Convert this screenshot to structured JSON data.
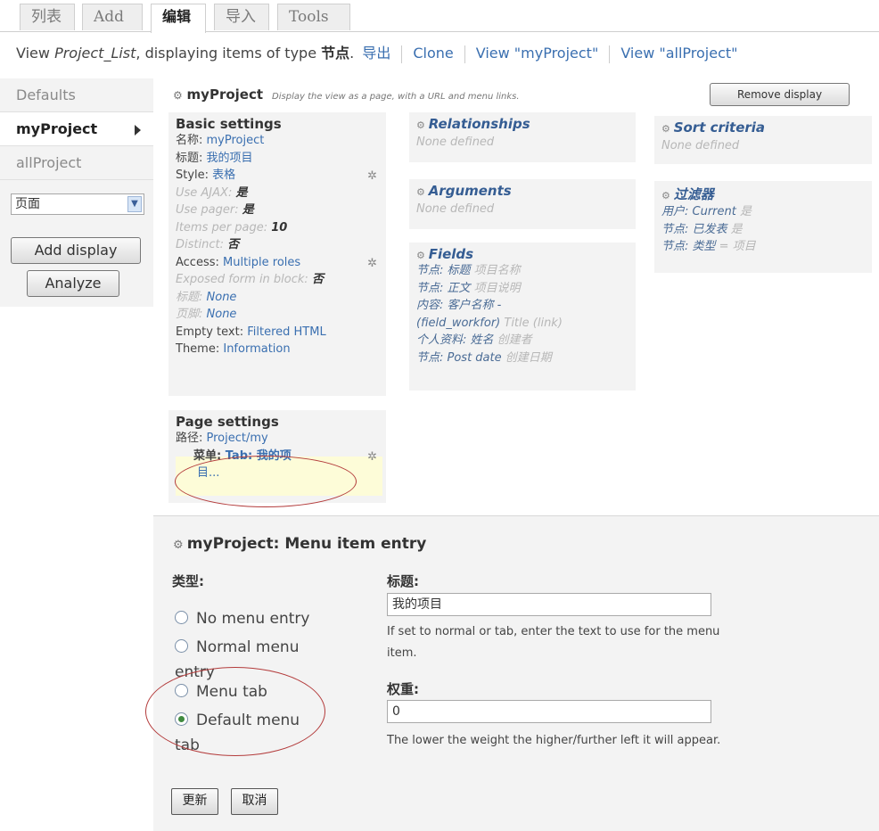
{
  "tabs": [
    {
      "label": "列表"
    },
    {
      "label": "Add"
    },
    {
      "label": "编辑",
      "active": true
    },
    {
      "label": "导入"
    },
    {
      "label": "Tools"
    }
  ],
  "header": {
    "prefix": "View ",
    "view_name": "Project_List",
    "mid": ", displaying items of type ",
    "type": "节点",
    "dot": ".",
    "links": [
      "导出",
      "Clone",
      "View \"myProject\"",
      "View \"allProject\""
    ]
  },
  "sidebar": {
    "items": [
      "Defaults",
      "myProject",
      "allProject"
    ],
    "select_value": "页面",
    "add_display": "Add display",
    "analyze": "Analyze"
  },
  "display": {
    "name": "myProject",
    "desc": "Display the view as a page, with a URL and menu links.",
    "remove_button": "Remove display"
  },
  "basic_settings": {
    "title": "Basic settings",
    "rows": [
      {
        "label": "名称: ",
        "value": "myProject"
      },
      {
        "label": "标题: ",
        "value": "我的项目"
      },
      {
        "label": "Style: ",
        "value": "表格"
      },
      {
        "label": "Use AJAX: ",
        "value": "是"
      },
      {
        "label": "Use pager: ",
        "value": "是"
      },
      {
        "label": "Items per page: ",
        "value": "10"
      },
      {
        "label": "Distinct: ",
        "value": "否"
      },
      {
        "label": "Access: ",
        "value": "Multiple roles"
      },
      {
        "label": "Exposed form in block: ",
        "value": "否"
      },
      {
        "label": "标题: ",
        "value": "None"
      },
      {
        "label": "页脚: ",
        "value": "None"
      },
      {
        "label": "Empty text: ",
        "value": "Filtered HTML"
      },
      {
        "label": "Theme: ",
        "value": "Information"
      }
    ]
  },
  "page_settings": {
    "title": "Page settings",
    "path_label": "路径: ",
    "path_value": "Project/my",
    "menu_label": "菜单: ",
    "menu_value": "Tab: 我的项",
    "menu_more": "目..."
  },
  "relationships": {
    "title": "Relationships",
    "none": "None defined"
  },
  "arguments": {
    "title": "Arguments",
    "none": "None defined"
  },
  "fields": {
    "title": "Fields",
    "rows": [
      {
        "label": "节点: 标题",
        "muted": " 项目名称"
      },
      {
        "label": "节点: 正文",
        "muted": " 项目说明"
      },
      {
        "label": "内容: 客户名称 -",
        "muted": ""
      },
      {
        "label": "(field_workfor)",
        "muted": " Title (link)"
      },
      {
        "label": "个人资料: 姓名",
        "muted": " 创建者"
      },
      {
        "label": "节点: Post date",
        "muted": " 创建日期"
      }
    ]
  },
  "sort": {
    "title": "Sort criteria",
    "none": "None defined"
  },
  "filters": {
    "title": "过滤器",
    "rows": [
      {
        "label": "用户: Current",
        "muted": " 是"
      },
      {
        "label": "节点: 已发表",
        "muted": " 是"
      },
      {
        "label": "节点: 类型",
        "muted": " = 项目"
      }
    ]
  },
  "menu_item": {
    "title": "myProject: Menu item entry",
    "type_label": "类型:",
    "options": [
      {
        "label": "No menu entry",
        "checked": false
      },
      {
        "label": "Normal menu entry",
        "checked": false
      },
      {
        "label": "Menu tab",
        "checked": false
      },
      {
        "label": "Default menu tab",
        "checked": true
      }
    ],
    "title_label": "标题:",
    "title_value": "我的项目",
    "title_help": "If set to normal or tab, enter the text to use for the menu item.",
    "weight_label": "权重:",
    "weight_value": "0",
    "weight_help": "The lower the weight the higher/further left it will appear.",
    "update_button": "更新",
    "cancel_button": "取消"
  }
}
